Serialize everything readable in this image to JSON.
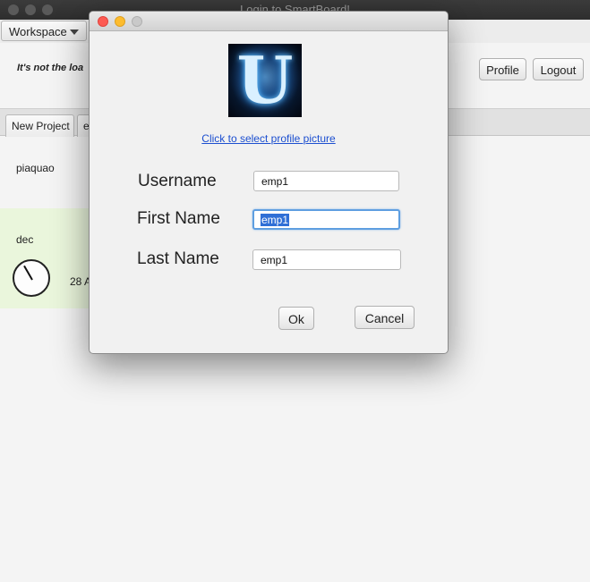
{
  "main_window": {
    "title": "Login to SmartBoard!",
    "menu": {
      "workspace_label": "Workspace"
    },
    "tagline": "It's not the loa",
    "profile_label": "Profile",
    "logout_label": "Logout",
    "tabs": [
      {
        "label": "New Project"
      },
      {
        "label": "e"
      }
    ],
    "projects": [
      {
        "name": "piaquao"
      },
      {
        "name": "dec",
        "date": "28 A"
      }
    ]
  },
  "dialog": {
    "avatar_letter": "U",
    "select_picture_link": "Click to select profile picture",
    "fields": {
      "username": {
        "label": "Username",
        "value": "emp1"
      },
      "first_name": {
        "label": "First Name",
        "value": "emp1"
      },
      "last_name": {
        "label": "Last Name",
        "value": "emp1"
      }
    },
    "ok_label": "Ok",
    "cancel_label": "Cancel"
  },
  "colors": {
    "link": "#1c4fd0",
    "selection": "#2f6fd6",
    "focus_ring": "#5e9ee0",
    "project_highlight": "#eaf6dc",
    "close": "#fd5a52",
    "minimize": "#fdbc2e"
  }
}
